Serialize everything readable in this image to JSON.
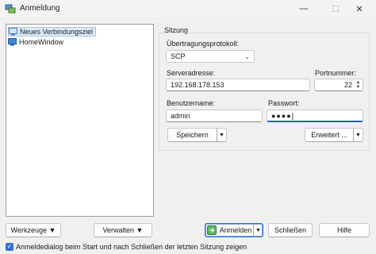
{
  "window": {
    "title": "Anmeldung",
    "minimize_glyph": "—",
    "maximize_glyph": "☐",
    "close_glyph": "✕"
  },
  "site_tree": {
    "items": [
      {
        "label": "Neues Verbindungsziel",
        "icon": "new-site-icon",
        "selected": true
      },
      {
        "label": "HomeWindow",
        "icon": "monitor-icon",
        "selected": false
      }
    ]
  },
  "session": {
    "group_label": "Sitzung",
    "protocol_label": "Übertragungsprotokoll:",
    "protocol_value": "SCP",
    "host_label": "Serveradresse:",
    "host_value": "192.168.178.153",
    "port_label": "Portnummer:",
    "port_value": "22",
    "user_label": "Benutzername:",
    "user_value": "admin",
    "password_label": "Passwort:",
    "password_value": "●●●●",
    "save_label": "Speichern",
    "advanced_label": "Erweitert ..."
  },
  "footer": {
    "tools_label": "Werkzeuge",
    "manage_label": "Verwalten",
    "login_label": "Anmelden",
    "close_label": "Schließen",
    "help_label": "Hilfe",
    "checkbox_label": "Anmeldedialog beim Start und nach Schließen der letzten Sitzung zeigen",
    "checkbox_checked": true
  },
  "colors": {
    "accent": "#2f6fd6",
    "selection": "#dcebfc"
  }
}
